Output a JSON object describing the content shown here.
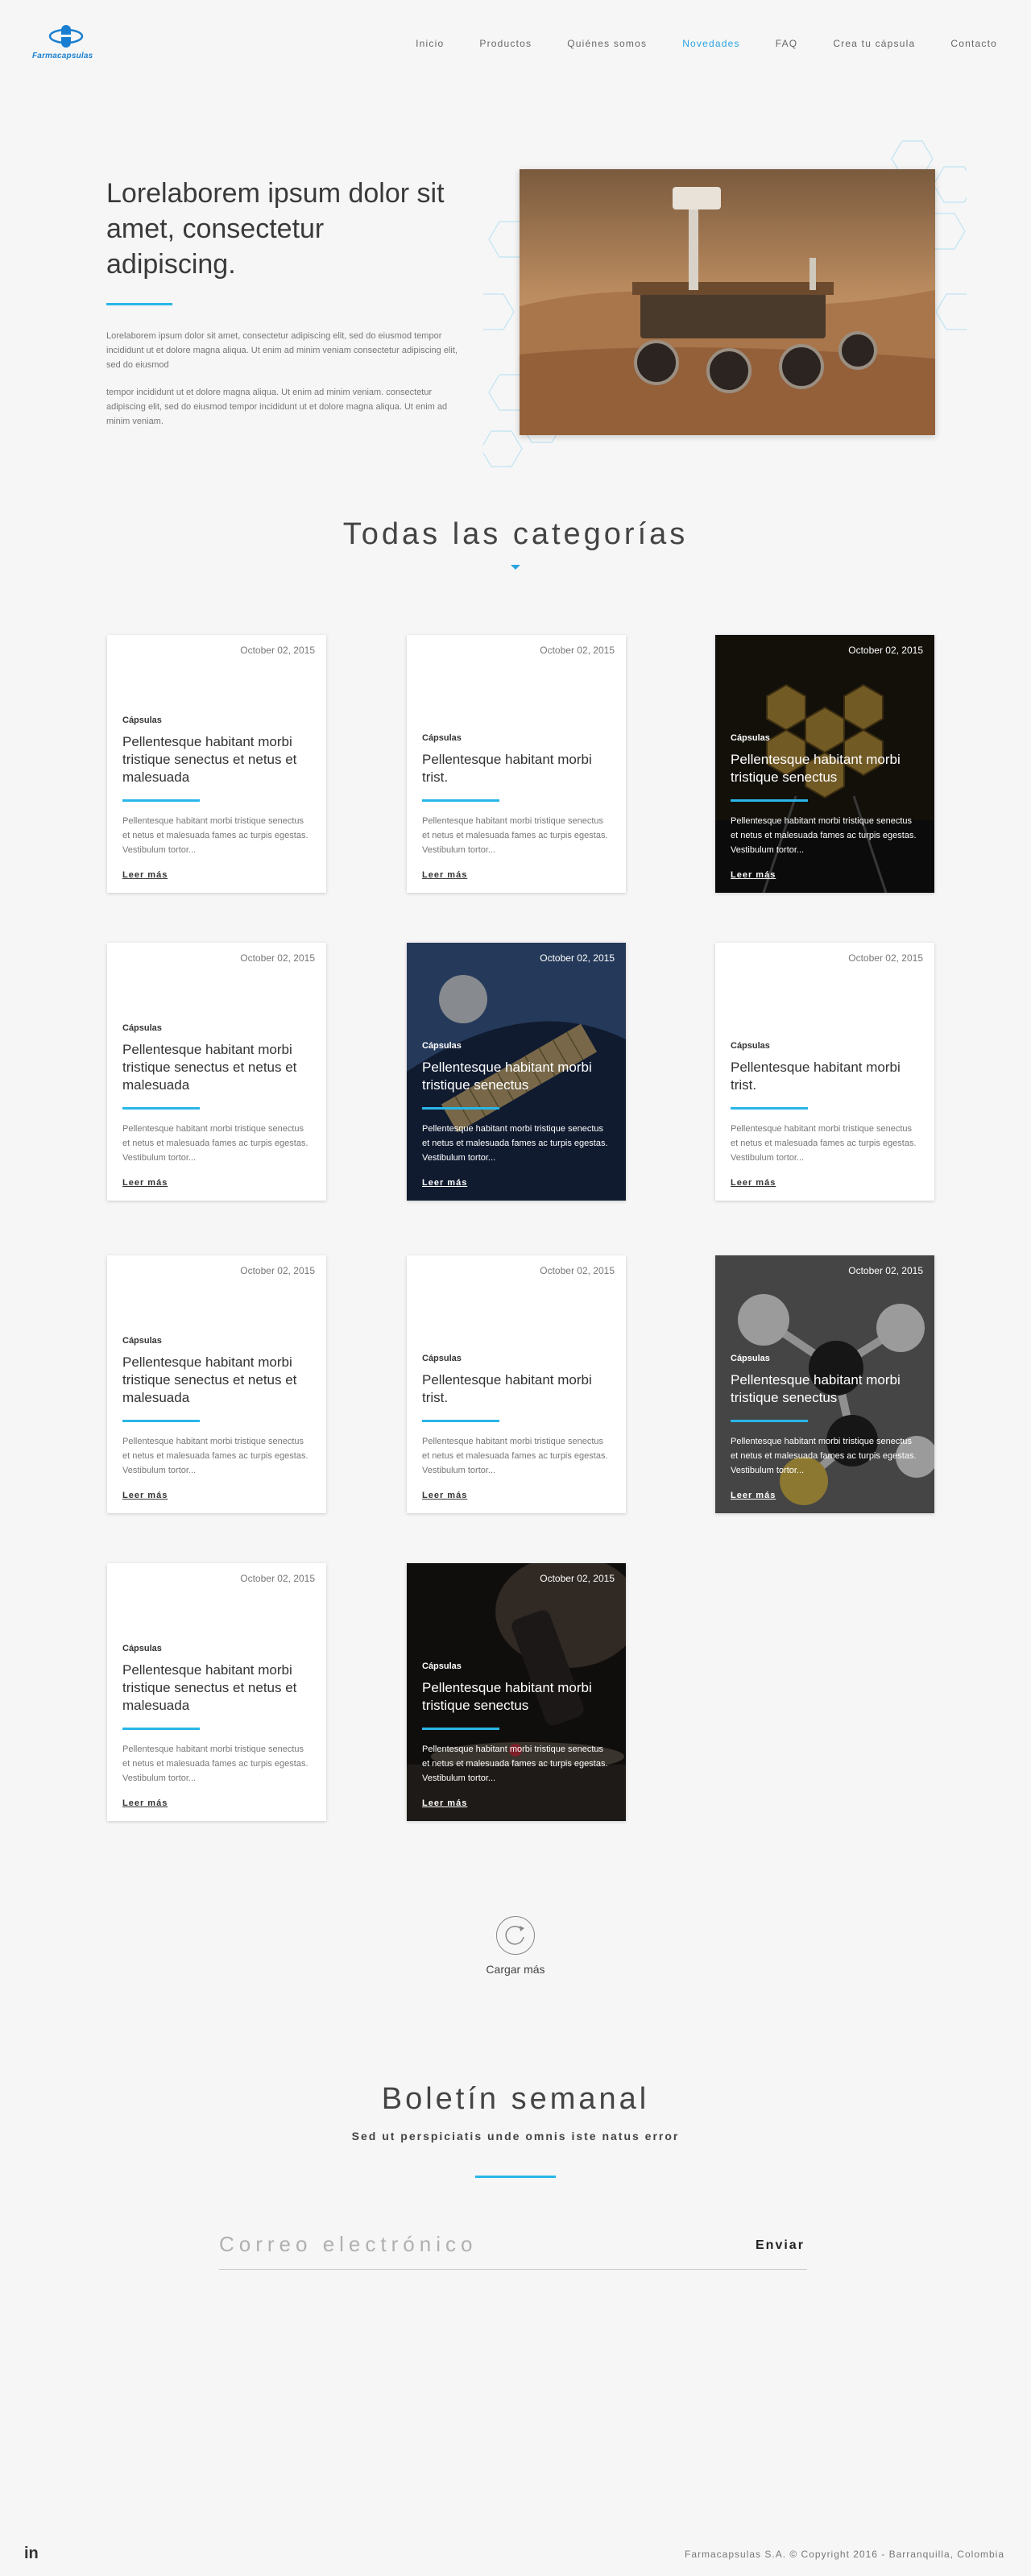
{
  "header": {
    "logo_text": "Farmacapsulas",
    "nav": [
      "Inicio",
      "Productos",
      "Quiénes somos",
      "Novedades",
      "FAQ",
      "Crea tu cápsula",
      "Contacto"
    ],
    "active_nav": "Novedades"
  },
  "hero": {
    "title": "Lorelaborem ipsum dolor sit amet, consectetur adipiscing.",
    "paragraph_1": "Lorelaborem ipsum dolor sit amet, consectetur adipiscing elit, sed do eiusmod tempor incididunt ut et dolore magna aliqua. Ut enim ad minim veniam consectetur adipiscing elit, sed do eiusmod",
    "paragraph_2": "tempor incididunt ut et dolore magna aliqua. Ut enim ad minim veniam. consectetur adipiscing elit, sed do eiusmod tempor incididunt ut et dolore magna aliqua. Ut enim ad minim veniam."
  },
  "categories": {
    "title": "Todas las categorías",
    "cards": [
      {
        "date": "October 02, 2015",
        "category": "Cápsulas",
        "title": "Pellentesque habitant morbi tristique senectus et netus et malesuada",
        "excerpt": "Pellentesque habitant morbi tristique senectus et netus et malesuada fames ac turpis egestas. Vestibulum tortor...",
        "more": "Leer más",
        "image": ""
      },
      {
        "date": "October 02, 2015",
        "category": "Cápsulas",
        "title": "Pellentesque habitant morbi trist.",
        "excerpt": "Pellentesque habitant morbi tristique senectus et netus et malesuada fames ac turpis egestas. Vestibulum tortor...",
        "more": "Leer más",
        "image": ""
      },
      {
        "date": "October 02, 2015",
        "category": "Cápsulas",
        "title": "Pellentesque habitant morbi tristique senectus",
        "excerpt": "Pellentesque habitant morbi tristique senectus et netus et malesuada fames ac turpis egestas. Vestibulum tortor...",
        "more": "Leer más",
        "image": "telescope"
      },
      {
        "date": "October 02, 2015",
        "category": "Cápsulas",
        "title": "Pellentesque habitant morbi tristique senectus et netus et malesuada",
        "excerpt": "Pellentesque habitant morbi tristique senectus et netus et malesuada fames ac turpis egestas. Vestibulum tortor...",
        "more": "Leer más",
        "image": ""
      },
      {
        "date": "October 02, 2015",
        "category": "Cápsulas",
        "title": "Pellentesque habitant morbi tristique senectus",
        "excerpt": "Pellentesque habitant morbi tristique senectus et netus et malesuada fames ac turpis egestas. Vestibulum tortor...",
        "more": "Leer más",
        "image": "satellite"
      },
      {
        "date": "October 02, 2015",
        "category": "Cápsulas",
        "title": "Pellentesque habitant morbi trist.",
        "excerpt": "Pellentesque habitant morbi tristique senectus et netus et malesuada fames ac turpis egestas. Vestibulum tortor...",
        "more": "Leer más",
        "image": ""
      },
      {
        "date": "October 02, 2015",
        "category": "Cápsulas",
        "title": "Pellentesque habitant morbi tristique senectus et netus et malesuada",
        "excerpt": "Pellentesque habitant morbi tristique senectus et netus et malesuada fames ac turpis egestas. Vestibulum tortor...",
        "more": "Leer más",
        "image": ""
      },
      {
        "date": "October 02, 2015",
        "category": "Cápsulas",
        "title": "Pellentesque habitant morbi trist.",
        "excerpt": "Pellentesque habitant morbi tristique senectus et netus et malesuada fames ac turpis egestas. Vestibulum tortor...",
        "more": "Leer más",
        "image": ""
      },
      {
        "date": "October 02, 2015",
        "category": "Cápsulas",
        "title": "Pellentesque habitant morbi tristique senectus",
        "excerpt": "Pellentesque habitant morbi tristique senectus et netus et malesuada fames ac turpis egestas. Vestibulum tortor...",
        "more": "Leer más",
        "image": "molecules"
      },
      {
        "date": "October 02, 2015",
        "category": "Cápsulas",
        "title": "Pellentesque habitant morbi tristique senectus et netus et malesuada",
        "excerpt": "Pellentesque habitant morbi tristique senectus et netus et malesuada fames ac turpis egestas. Vestibulum tortor...",
        "more": "Leer más",
        "image": ""
      },
      {
        "date": "October 02, 2015",
        "category": "Cápsulas",
        "title": "Pellentesque habitant morbi tristique senectus",
        "excerpt": "Pellentesque habitant morbi tristique senectus et netus et malesuada fames ac turpis egestas. Vestibulum tortor...",
        "more": "Leer más",
        "image": "microscope"
      }
    ],
    "load_more": "Cargar más"
  },
  "newsletter": {
    "title": "Boletín semanal",
    "subtitle": "Sed ut perspiciatis unde omnis iste natus error",
    "email_placeholder": "Correo electrónico",
    "send_label": "Enviar"
  },
  "footer": {
    "social": "in",
    "copyright": "Farmacapsulas S.A. © Copyright 2016 - Barranquilla, Colombia"
  },
  "colors": {
    "accent": "#29a3e0",
    "rule": "#29b6e8",
    "background": "#f6f6f6"
  }
}
